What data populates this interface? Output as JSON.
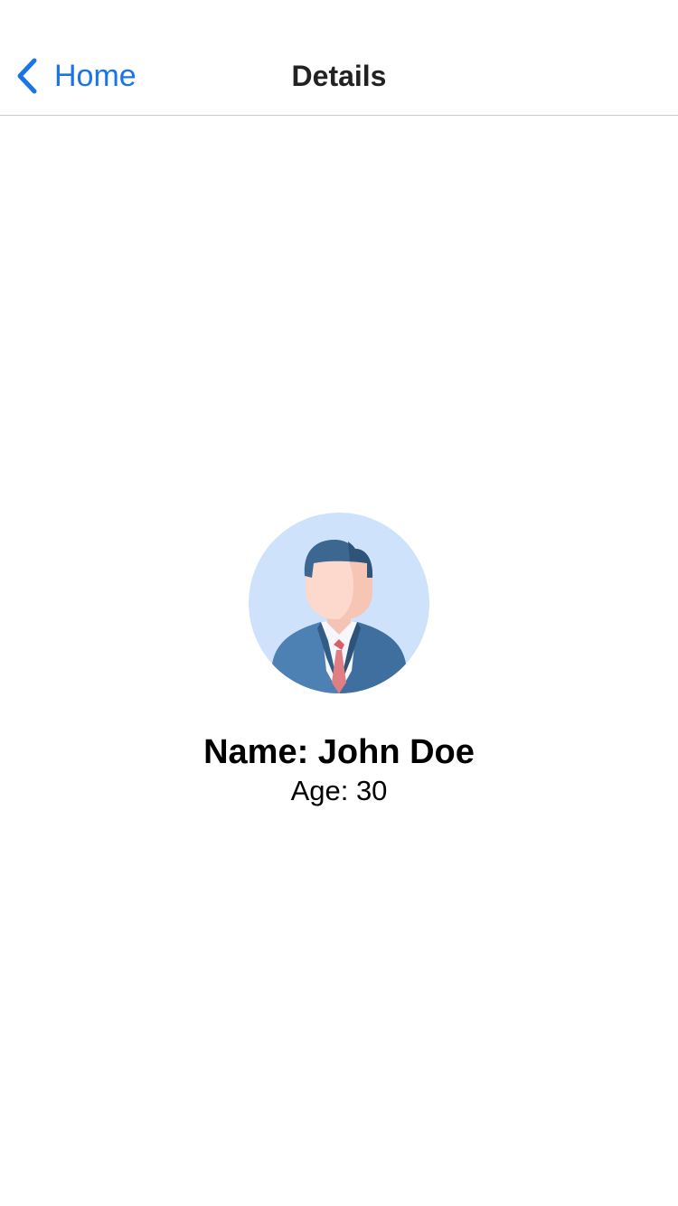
{
  "nav": {
    "back_label": "Home",
    "back_icon": "chevron-left-icon",
    "title": "Details",
    "accent_color": "#1a73e8"
  },
  "profile": {
    "avatar_icon": "businessman-avatar-icon",
    "name_line": "Name: John Doe",
    "age_line": "Age: 30"
  }
}
